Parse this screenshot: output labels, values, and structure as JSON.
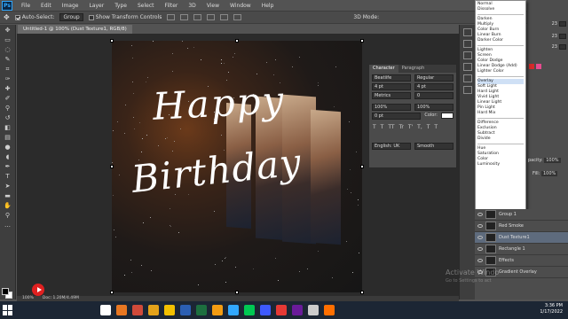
{
  "menubar": {
    "logo": "Ps",
    "items": [
      "File",
      "Edit",
      "Image",
      "Layer",
      "Type",
      "Select",
      "Filter",
      "3D",
      "View",
      "Window",
      "Help"
    ]
  },
  "options": {
    "auto_select_label": "Auto-Select:",
    "auto_select_value": "Group",
    "transform_label": "Show Transform Controls",
    "mode_label": "3D Mode:"
  },
  "document": {
    "tab_title": "Untitled-1 @ 100% (Dust Texture1, RGB/8)",
    "status_zoom": "100%",
    "status_doc": "Doc: 1.20M/4.49M"
  },
  "artwork": {
    "line1": "Happy",
    "line2": "Birthday"
  },
  "character_panel": {
    "tabs": [
      "Character",
      "Paragraph"
    ],
    "font_family": "Beatiife",
    "font_style": "Regular",
    "size": "4 pt",
    "leading": "4 pt",
    "kerning": "Metrics",
    "tracking": "0",
    "vscale": "100%",
    "hscale": "100%",
    "baseline": "0 pt",
    "color_label": "Color:",
    "style_buttons": [
      "T",
      "T",
      "TT",
      "Tr",
      "T'",
      "T,",
      "T",
      "T"
    ],
    "language": "English: UK",
    "antialias": "Smooth"
  },
  "blend_modes": {
    "groups": [
      [
        "Normal",
        "Dissolve"
      ],
      [
        "Darken",
        "Multiply",
        "Color Burn",
        "Linear Burn",
        "Darker Color"
      ],
      [
        "Lighten",
        "Screen",
        "Color Dodge",
        "Linear Dodge (Add)",
        "Lighter Color"
      ],
      [
        "Overlay",
        "Soft Light",
        "Hard Light",
        "Vivid Light",
        "Linear Light",
        "Pin Light",
        "Hard Mix"
      ],
      [
        "Difference",
        "Exclusion",
        "Subtract",
        "Divide"
      ],
      [
        "Hue",
        "Saturation",
        "Color",
        "Luminosity"
      ]
    ]
  },
  "color_panel": {
    "values": [
      "23",
      "23",
      "23"
    ]
  },
  "layers_panel": {
    "opacity_label": "pacity:",
    "opacity_value": "100%",
    "fill_label": "Fill:",
    "fill_value": "100%",
    "rows": [
      {
        "name": "Group 1",
        "selected": false
      },
      {
        "name": "Red Smoke",
        "selected": false
      },
      {
        "name": "Dust Texture1",
        "selected": true
      },
      {
        "name": "Rectangle 1",
        "selected": false
      },
      {
        "name": "Effects",
        "selected": false
      },
      {
        "name": "Gradient Overlay",
        "selected": false
      }
    ]
  },
  "watermark": {
    "line1": "Activate Windo",
    "line2": "Go to Settings to act"
  },
  "taskbar": {
    "time": "3:36 PM",
    "date": "1/17/2022",
    "icon_colors": [
      "#ffffff",
      "#e87722",
      "#d04a3a",
      "#e3a21a",
      "#f3c000",
      "#2b5fb3",
      "#1d6f3f",
      "#f39c12",
      "#31a8ff",
      "#00c853",
      "#3d5afe",
      "#e53935",
      "#6a1b9a",
      "#cccccc",
      "#ff6f00"
    ]
  }
}
